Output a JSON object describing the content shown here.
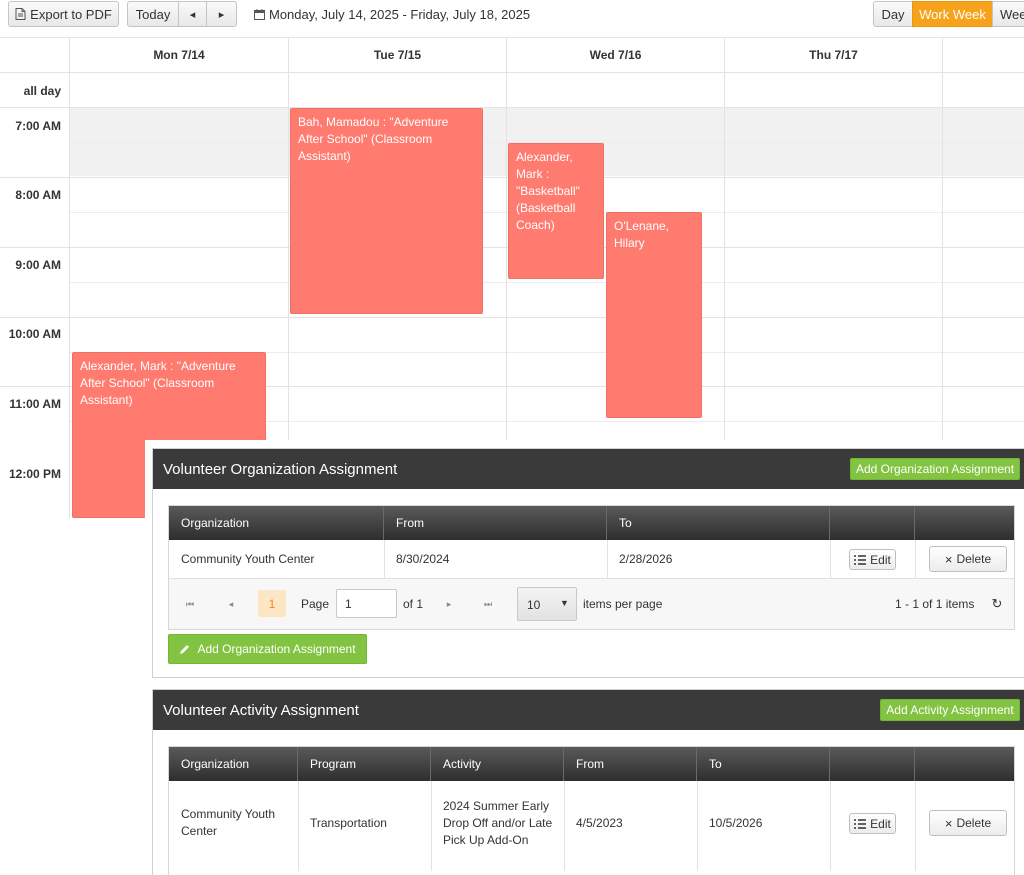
{
  "toolbar": {
    "export_label": "Export to PDF",
    "today_label": "Today",
    "prev_glyph": "◂",
    "next_glyph": "▸",
    "date_range": "Monday, July 14, 2025 - Friday, July 18, 2025",
    "views": [
      {
        "label": "Day",
        "active": false
      },
      {
        "label": "Work Week",
        "active": true
      },
      {
        "label": "Week",
        "active": false
      }
    ]
  },
  "calendar": {
    "days": [
      "Mon 7/14",
      "Tue 7/15",
      "Wed 7/16",
      "Thu 7/17"
    ],
    "all_day_label": "all day",
    "times": [
      "7:00 AM",
      "8:00 AM",
      "9:00 AM",
      "10:00 AM",
      "11:00 AM",
      "12:00 PM"
    ],
    "events": [
      {
        "text": "Bah, Mamadou : \"Adventure After School\" (Classroom Assistant)"
      },
      {
        "text": "Alexander, Mark : \"Basketball\" (Basketball Coach)"
      },
      {
        "text": "O'Lenane, Hilary"
      },
      {
        "text": "Alexander, Mark : \"Adventure After School\" (Classroom Assistant)"
      }
    ]
  },
  "org_panel": {
    "title": "Volunteer Organization Assignment",
    "header_add_label": "Add Organization Assignment",
    "columns": [
      "Organization",
      "From",
      "To"
    ],
    "rows": [
      {
        "organization": "Community Youth Center",
        "from": "8/30/2024",
        "to": "2/28/2026",
        "edit": "Edit",
        "delete": "Delete"
      }
    ],
    "pager": {
      "current_page": "1",
      "page_label": "Page",
      "page_value": "1",
      "of_label": "of 1",
      "page_size": "10",
      "items_per_page_label": "items per page",
      "summary": "1 - 1 of 1 items"
    },
    "footer_add_label": "Add Organization Assignment"
  },
  "activity_panel": {
    "title": "Volunteer Activity Assignment",
    "header_add_label": "Add Activity Assignment",
    "columns": [
      "Organization",
      "Program",
      "Activity",
      "From",
      "To"
    ],
    "rows": [
      {
        "organization": "Community Youth Center",
        "program": "Transportation",
        "activity": "2024 Summer Early Drop Off and/or Late Pick Up Add-On",
        "from": "4/5/2023",
        "to": "10/5/2026",
        "edit": "Edit",
        "delete": "Delete"
      }
    ]
  },
  "colors": {
    "event": "#ff7b70",
    "accent_orange": "#f6a21a",
    "green": "#82c341",
    "panel_header": "#3a3a3a"
  }
}
